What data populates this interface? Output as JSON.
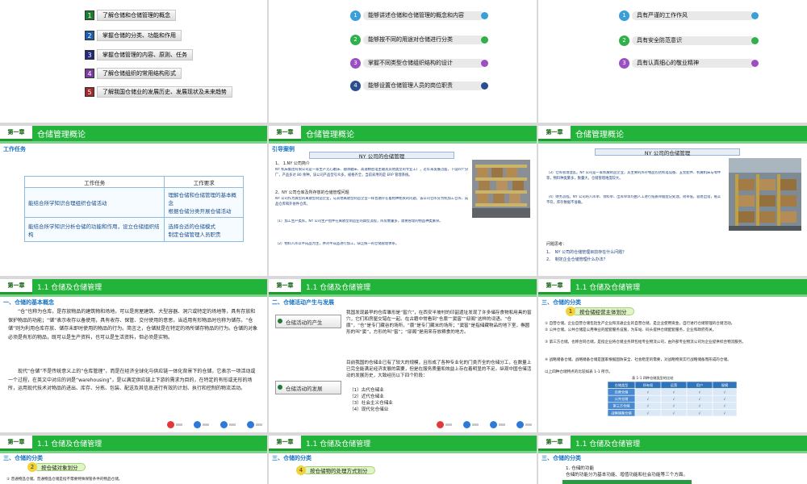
{
  "objectives": [
    {
      "num": "1",
      "text": "了解仓储和仓储管理的概念",
      "color": "#1e7b2f"
    },
    {
      "num": "2",
      "text": "掌握仓储的分类、功能和作用",
      "color": "#1f5fa8"
    },
    {
      "num": "3",
      "text": "掌握仓储管理的内容、原则、任务",
      "color": "#22287a"
    },
    {
      "num": "4",
      "text": "了解仓储组织的常用结构形式",
      "color": "#7a3ca0"
    },
    {
      "num": "5",
      "text": "了解我国仓储业的发展历史、发展现状及未来趋势",
      "color": "#a02a2a"
    }
  ],
  "abilities": [
    {
      "num": "1",
      "text": "能够讲述仓储和仓储管理的概念和内容",
      "color": "#3a9fd8"
    },
    {
      "num": "2",
      "text": "能够按不同的用途对仓储进行分类",
      "color": "#2fb04a"
    },
    {
      "num": "3",
      "text": "掌握不同类型仓储组织结构的设计",
      "color": "#9a4fc2"
    },
    {
      "num": "4",
      "text": "能够设置仓储管理人员的岗位职责",
      "color": "#2a4d8f"
    }
  ],
  "qualities": [
    {
      "num": "1",
      "text": "具有严谨的工作作风",
      "color": "#3a9fd8"
    },
    {
      "num": "2",
      "text": "具有安全防范意识",
      "color": "#2fb04a"
    },
    {
      "num": "3",
      "text": "具有认真细心的敬业精神",
      "color": "#9a4fc2"
    }
  ],
  "chapter_tag": "第一章",
  "chapter_title": "仓储管理概论",
  "section_title": "1.1 仓储及仓储管理",
  "slide4": {
    "sub": "工作任务",
    "headers": [
      "工作任务",
      "工作要求"
    ],
    "rows": [
      [
        "能结合所学知识合理组织仓储活动",
        "理解仓储和仓储管理的基本概念\n根据仓储分类开展仓储活动"
      ],
      [
        "能结合所学知识分析仓储的功能和作用，设立仓储组织结构",
        "选择合适的仓储模式\n制定仓储管理人员职责"
      ]
    ]
  },
  "slide5": {
    "sub": "引导案例",
    "case_title": "NY 公司的仓储管理",
    "heading1": "1、 1.NY 公司简介",
    "p1": "NY 机床集团有限公司是一家生产无心磨床、轴承磨床、高速精密电主轴及其他类型的专业工厂，近年来发展迅猛，下设四个分厂，产品多达 80 余种，该公司产品型号众多，规格齐全，当前采用的是 ERP 管理系统。",
    "heading2": "2、NY 公司仓库及所存放的仓储管理问题",
    "p2": "NY 公司作为典型的离散型制造企业，与其他离散型制造企业一样普遍存在着相种相关的问题，该公司仓库分为机加工仓库、成品仓库和外协件仓库。",
    "p3": "（1）加工生产类库。NY 公司生产组件在离散型制造业的典型流程，库房数量多，需要管理的物品种类繁杂。",
    "p4": "（2）物料入库以半成品为主，并对半成品进行加工，缺乏统一的仓储管理体系。"
  },
  "slide6": {
    "case_title": "NY 公司的仓储管理",
    "p1": "（3）仓库管理混乱。NY 公司是一家机械制造企业，其主要的库存物品包括机电设备、五金配件、机械机床与零件等，物料种类繁多，数量大，仓储管理难度较大。",
    "p2": "（4）财务流程。NY 公司的入库单、领料单、出库单等均由人工进行纸质单据登记处理，效率低，容易出错，账实不符，库存数据不准确。",
    "q_title": "问题思考：",
    "q1": "1、　NY 公司的仓储管理目前存在什么问题？",
    "q2": "2、　制定企业仓储管理什么办法？"
  },
  "slide7": {
    "sub": "一、仓储的基本概念",
    "p1": "“仓”也称为仓库，是存放物品的建筑物和场地，可以是房屋建筑、大型容器、洞穴或特定的场地等，具有存放和保护物品的功能；“储”表示收存以备使用，具有收存、保管、交付使用的意思，当适用有形物品时也称为储存。“仓储”则为利用仓库存放、储存未即时使用的物品的行为。简言之，仓储就是在特定的场所储存物品的行为。仓储的对象必须是有形的物品，既可以是生产资料，也可以是生活资料，但必须是实物。",
    "p2": "现代“仓储”不是传统意义上的“仓库管理”，而是在经济全球化与供应链一体化背景下的仓储，它表示一项活动或一个过程，在英文中对应的词是“warehousing”，是以满足供应链上下游的需求为目的，在特定的有形或无形的场所，运用现代技术对物品的进出、库存、分拣、包装、配送及其信息进行有效的计划、执行和控制的物流活动。"
  },
  "slide8": {
    "sub": "二、仓储活动产生与发展",
    "label1": "仓储活动的产生",
    "p1": "我国发现最早的仓库雏形是“窖穴”，在西安半坡村的印韶遗址发现了许多储存食物和用具的窖穴，它们和房屋交错在一起。在古籍中常看到“仓廪”“窦窖”“邸阁”这样的词语。“仓廪”，“仓”是专门藏谷的场所，“廪”是专门藏米的场所；“窦窖”是指储藏物品的地下室，椭圆形的叫“窦”，方形的叫“窖”；“邸阁”是用来存放粮食的地方。",
    "label2": "仓储活动的发展",
    "p2": "目前我国的仓储业已有了较大的规模，且形成了各种专业化的门类齐全的仓储分工，在数量上已完全能满足经济发展的需要，但是在服务质量和效益上存在着明显的不足。纵观中国仓储活动的发展历史，大致经历以下四个阶段：",
    "stages": [
      "（1）古代仓储业",
      "（2）近代仓储业",
      "（3）社会主义仓储业",
      "（4）现代化仓储业"
    ]
  },
  "slide9": {
    "sub": "三、仓储的分类",
    "bullet_num": "1",
    "bullet": "按仓储经营主体划分",
    "p1": "① 自营仓储。企业自营仓储包括生产企业和流通企业的自营仓储，是企业使用资金，自行进行仓储管理的仓储活动。",
    "p2": "② 公共仓储。公共仓储是公用事业的配套服务设施，为车站、码头提供仓储配套服务，企业和政府有关。",
    "p3": "③ 第三方仓储。也称合同仓储，是指企业将仓储业务转包给专业物流公司，由外部专业物流公司为企业提供综合物流服务。",
    "p4": "④ 战略储备仓储。战略储备仓储是国家根据国防安全、社会稳定的需要，对战略物资实行战略储备而形成的仓储。",
    "table_caption": "以上四种仓储特点的比较如表 1-1 所示。",
    "table_title": "表 1-1  四种仓储类型的比较",
    "table_headers": [
      "仓储类型",
      "所有权",
      "运营",
      "用户",
      "规模"
    ],
    "table_rows": [
      [
        "自营仓储",
        "√",
        "√",
        "√",
        "√"
      ],
      [
        "公共仓储",
        "√",
        "√",
        "√",
        "√"
      ],
      [
        "第三方仓储",
        "√",
        "√",
        "√",
        "√"
      ],
      [
        "战略储备仓储",
        "√",
        "√",
        "√",
        "√"
      ]
    ]
  },
  "slide10": {
    "sub": "三、仓储的分类",
    "bullet_num": "2",
    "bullet": "按仓储对象划分",
    "p1": "① 普通物品仓储。普通物品仓储是指不需要特殊保管条件的物品仓储。"
  },
  "slide11": {
    "bullet_num": "4",
    "bullet": "按仓储物的处理方式划分"
  },
  "slide12": {
    "sub": "三、仓储的分类",
    "p1": "1. 仓储的功能",
    "p2": "仓储的功能分为基本功能、增值功能和社会功能等三个方面。"
  },
  "nav_colors": [
    "#e23838",
    "#2d7ad8",
    "#2d7ad8",
    "#2d7ad8"
  ]
}
